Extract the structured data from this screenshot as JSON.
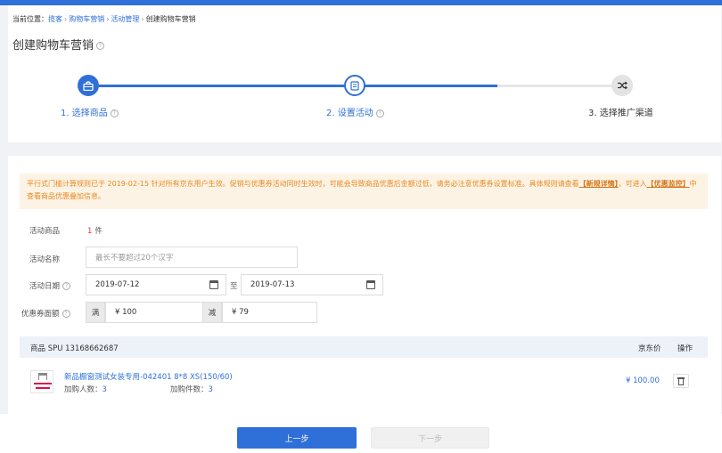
{
  "breadcrumb": {
    "prefix": "当前位置：",
    "items": [
      "揽客",
      "购物车营销",
      "活动管理",
      "创建购物车营销"
    ],
    "sep": "›"
  },
  "page_title": "创建购物车营销",
  "steps": [
    {
      "label": "1. 选择商品",
      "state": "done"
    },
    {
      "label": "2. 设置活动",
      "state": "active"
    },
    {
      "label": "3. 选择推广渠道",
      "state": "pending"
    }
  ],
  "notice": {
    "text_a": "平行式门槛计算规则已于 2019-02-15 针对所有京东用户生效。促销与优惠券活动同时生效时，可能会导致商品优惠后金额过低，请务必注意优惠券设置标准。具体规则请查看",
    "link1": "【新规详情】",
    "text_b": "，可进入",
    "link2": "【优惠监控】",
    "text_c": "中查看商品优惠叠加信息。"
  },
  "form": {
    "goods_label": "活动商品",
    "goods_count": "1",
    "goods_unit": "件",
    "name_label": "活动名称",
    "name_placeholder": "最长不要超过20个汉字",
    "date_label": "活动日期",
    "start_date": "2019-07-12",
    "date_sep": "至",
    "end_date": "2019-07-13",
    "coupon_label": "优惠券面额",
    "full_label": "满",
    "full_value": "¥ 100",
    "minus_label": "减",
    "minus_value": "¥ 79"
  },
  "table": {
    "col_goods": "商品 SPU 13168662687",
    "col_price": "京东价",
    "col_action": "操作",
    "rows": [
      {
        "name": "新品橱窗测试女装专用-042401 8*8 XS(150/60)",
        "buyers_label": "加购人数：",
        "buyers": "3",
        "qty_label": "加购件数：",
        "qty": "3",
        "price": "¥ 100.00"
      }
    ]
  },
  "buttons": {
    "prev": "上一步",
    "next": "下一步"
  },
  "colors": {
    "primary": "#2f6fd8",
    "warning_bg": "#fdf3e5",
    "warning_text": "#e8891f"
  }
}
